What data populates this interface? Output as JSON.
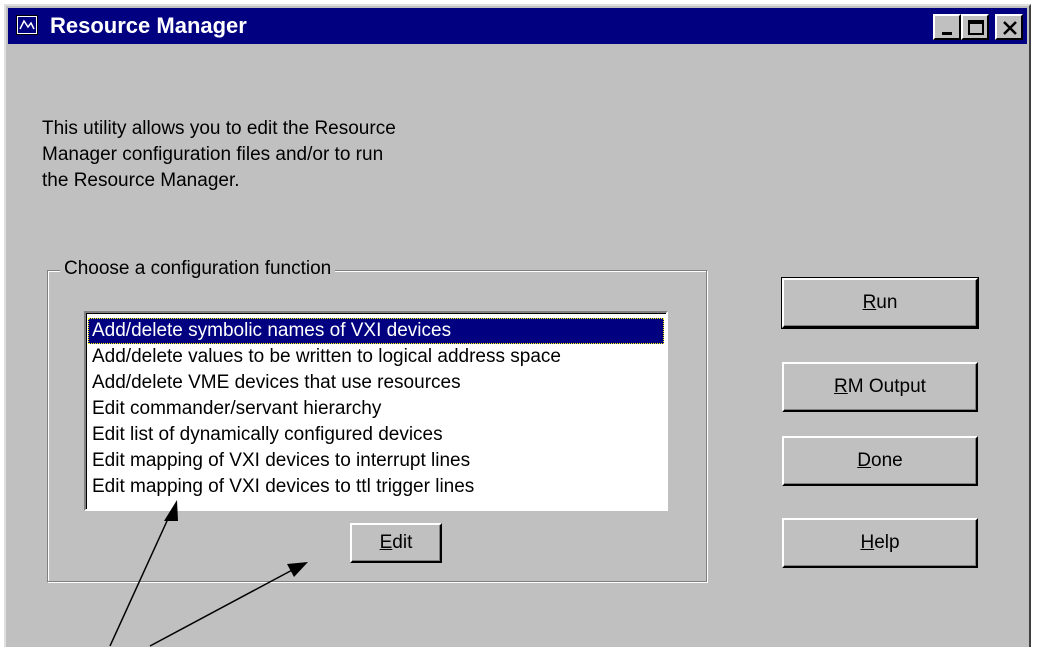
{
  "window": {
    "title": "Resource Manager",
    "icons": {
      "app": "resource-manager-app-icon",
      "minimize": "minimize-icon",
      "maximize": "maximize-icon",
      "close": "close-icon"
    }
  },
  "intro": {
    "lines": [
      "This utility allows you to edit the Resource",
      "Manager configuration files and/or to run",
      "the Resource Manager."
    ]
  },
  "config_group": {
    "label": "Choose a configuration function",
    "items": [
      "Add/delete symbolic names of VXI devices",
      "Add/delete values to be written to logical address space",
      "Add/delete VME devices that use resources",
      "Edit commander/servant hierarchy",
      "Edit list of dynamically configured devices",
      "Edit mapping of VXI devices to interrupt lines",
      "Edit mapping of VXI devices to ttl trigger lines"
    ],
    "selected_index": 0,
    "edit_button": {
      "mnemonic": "E",
      "rest": "dit"
    }
  },
  "buttons": {
    "run": {
      "mnemonic": "R",
      "rest": "un"
    },
    "rm_output": {
      "mnemonic": "R",
      "rest": "M Output"
    },
    "done": {
      "mnemonic": "D",
      "rest": "one"
    },
    "help": {
      "mnemonic": "H",
      "rest": "elp"
    }
  },
  "colors": {
    "title_bar": "#000080",
    "face": "#c0c0c0",
    "selection": "#000080"
  }
}
